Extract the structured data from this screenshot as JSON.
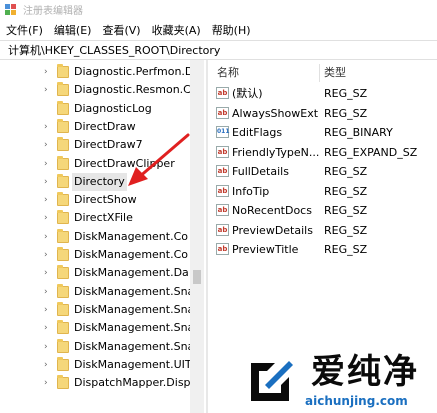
{
  "window": {
    "title": "注册表编辑器"
  },
  "menu": [
    "文件(F)",
    "编辑(E)",
    "查看(V)",
    "收藏夹(A)",
    "帮助(H)"
  ],
  "address": "计算机\\HKEY_CLASSES_ROOT\\Directory",
  "tree": {
    "items": [
      {
        "label": "Diagnostic.Perfmon.D",
        "expandable": true
      },
      {
        "label": "Diagnostic.Resmon.C",
        "expandable": true
      },
      {
        "label": "DiagnosticLog",
        "expandable": false
      },
      {
        "label": "DirectDraw",
        "expandable": true
      },
      {
        "label": "DirectDraw7",
        "expandable": true
      },
      {
        "label": "DirectDrawClipper",
        "expandable": true
      },
      {
        "label": "Directory",
        "expandable": true,
        "selected": true
      },
      {
        "label": "DirectShow",
        "expandable": true
      },
      {
        "label": "DirectXFile",
        "expandable": true
      },
      {
        "label": "DiskManagement.Co",
        "expandable": true
      },
      {
        "label": "DiskManagement.Co",
        "expandable": true
      },
      {
        "label": "DiskManagement.Da",
        "expandable": true
      },
      {
        "label": "DiskManagement.Sna",
        "expandable": true
      },
      {
        "label": "DiskManagement.Sna",
        "expandable": true
      },
      {
        "label": "DiskManagement.Sna",
        "expandable": true
      },
      {
        "label": "DiskManagement.Sna",
        "expandable": true
      },
      {
        "label": "DiskManagement.UIT",
        "expandable": true
      },
      {
        "label": "DispatchMapper.Disp",
        "expandable": true
      }
    ]
  },
  "values": {
    "headers": {
      "name": "名称",
      "type": "类型"
    },
    "rows": [
      {
        "icon": "string-value-icon",
        "name": "(默认)",
        "type": "REG_SZ"
      },
      {
        "icon": "string-value-icon",
        "name": "AlwaysShowExt",
        "type": "REG_SZ"
      },
      {
        "icon": "binary-value-icon",
        "name": "EditFlags",
        "type": "REG_BINARY"
      },
      {
        "icon": "string-value-icon",
        "name": "FriendlyTypeN...",
        "type": "REG_EXPAND_SZ"
      },
      {
        "icon": "string-value-icon",
        "name": "FullDetails",
        "type": "REG_SZ"
      },
      {
        "icon": "string-value-icon",
        "name": "InfoTip",
        "type": "REG_SZ"
      },
      {
        "icon": "string-value-icon",
        "name": "NoRecentDocs",
        "type": "REG_SZ"
      },
      {
        "icon": "string-value-icon",
        "name": "PreviewDetails",
        "type": "REG_SZ"
      },
      {
        "icon": "string-value-icon",
        "name": "PreviewTitle",
        "type": "REG_SZ"
      }
    ]
  },
  "watermark": {
    "title": "爱纯净",
    "url": "aichunjing.com"
  },
  "colors": {
    "arrow": "#e02020",
    "folder": "#f5d77a",
    "watermark_blue": "#1a6fc0"
  }
}
